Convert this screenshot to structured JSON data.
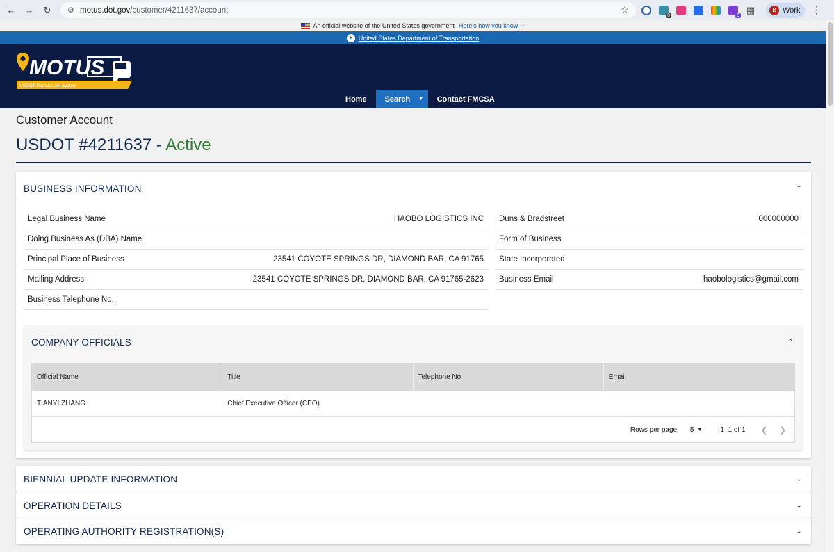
{
  "browser": {
    "url_host": "motus.dot.gov",
    "url_path": "/customer/4211637/account",
    "profile_initial": "B",
    "profile_label": "Work",
    "ext_badge_1": "0",
    "ext_badge_2": "8"
  },
  "gov_banner": {
    "text": "An official website of the United States government",
    "link": "Here’s how you know"
  },
  "dot_bar": {
    "link": "United States Department of Transportation"
  },
  "header": {
    "logo_text": "MOTUS",
    "logo_tagline": "USDOT Registration System",
    "nav": [
      {
        "label": "Home"
      },
      {
        "label": "Search"
      },
      {
        "label": "Contact FMCSA"
      }
    ]
  },
  "page": {
    "subtitle": "Customer Account",
    "title_prefix": "USDOT #4211637 - ",
    "status": "Active"
  },
  "business_info": {
    "heading": "BUSINESS INFORMATION",
    "left": [
      {
        "label": "Legal Business Name",
        "value": "HAOBO LOGISTICS INC"
      },
      {
        "label": "Doing Business As (DBA) Name",
        "value": ""
      },
      {
        "label": "Principal Place of Business",
        "value": "23541 COYOTE SPRINGS DR, DIAMOND BAR, CA 91765"
      },
      {
        "label": "Mailing Address",
        "value": "23541 COYOTE SPRINGS DR, DIAMOND BAR, CA 91765-2623"
      },
      {
        "label": "Business Telephone No.",
        "value": ""
      }
    ],
    "right": [
      {
        "label": "Duns & Bradstreet",
        "value": "000000000"
      },
      {
        "label": "Form of Business",
        "value": ""
      },
      {
        "label": "State Incorporated",
        "value": ""
      },
      {
        "label": "Business Email",
        "value": "haobologistics@gmail.com"
      }
    ]
  },
  "company_officials": {
    "heading": "COMPANY OFFICIALS",
    "columns": [
      "Official Name",
      "Title",
      "Telephone No",
      "Email"
    ],
    "rows": [
      {
        "name": "TIANYI ZHANG",
        "title": "Chief Executive Officer (CEO)",
        "phone": "",
        "email": ""
      }
    ],
    "pagination": {
      "rows_per_page_label": "Rows per page:",
      "rows_per_page": "5",
      "range": "1–1 of 1"
    }
  },
  "sections": [
    {
      "heading": "BIENNIAL UPDATE INFORMATION"
    },
    {
      "heading": "OPERATION DETAILS"
    },
    {
      "heading": "OPERATING AUTHORITY REGISTRATION(S)"
    }
  ]
}
